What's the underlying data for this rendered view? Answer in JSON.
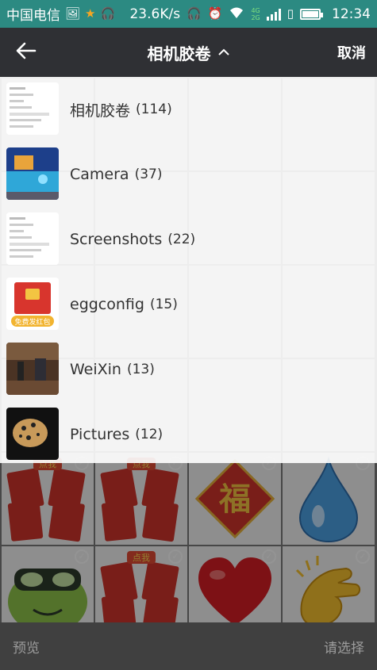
{
  "status_bar": {
    "carrier": "中国电信",
    "speed": "23.6K/s",
    "network_top": "4G",
    "network_bottom": "2G",
    "time": "12:34",
    "background": "#2c8a82"
  },
  "header": {
    "title": "相机胶卷",
    "cancel_label": "取消",
    "background": "#2f3034"
  },
  "albums": [
    {
      "name": "相机胶卷",
      "count": "(114)",
      "thumb_icon": "form-screenshot-thumb"
    },
    {
      "name": "Camera",
      "count": "(37)",
      "thumb_icon": "aquarium-photo-thumb"
    },
    {
      "name": "Screenshots",
      "count": "(22)",
      "thumb_icon": "form-screenshot-thumb"
    },
    {
      "name": "eggconfig",
      "count": "(15)",
      "thumb_icon": "red-envelope-thumb"
    },
    {
      "name": "WeiXin",
      "count": "(13)",
      "thumb_icon": "indoor-photo-thumb"
    },
    {
      "name": "Pictures",
      "count": "(12)",
      "thumb_icon": "leopard-photo-thumb"
    }
  ],
  "grid_images": {
    "row1": [
      "red-envelope-sticker",
      "red-envelope-sticker",
      "fu-character-sticker",
      "water-drop-sticker"
    ],
    "row2": [
      "frog-sticker",
      "red-envelope-sticker",
      "red-heart-sticker",
      "clapping-hands-sticker"
    ]
  },
  "thumb_texts": {
    "red_envelope_button": "免费发红包",
    "sticker_tag": "点我",
    "fu_character": "福"
  },
  "bottom_bar": {
    "preview_label": "预览",
    "select_label": "请选择"
  }
}
